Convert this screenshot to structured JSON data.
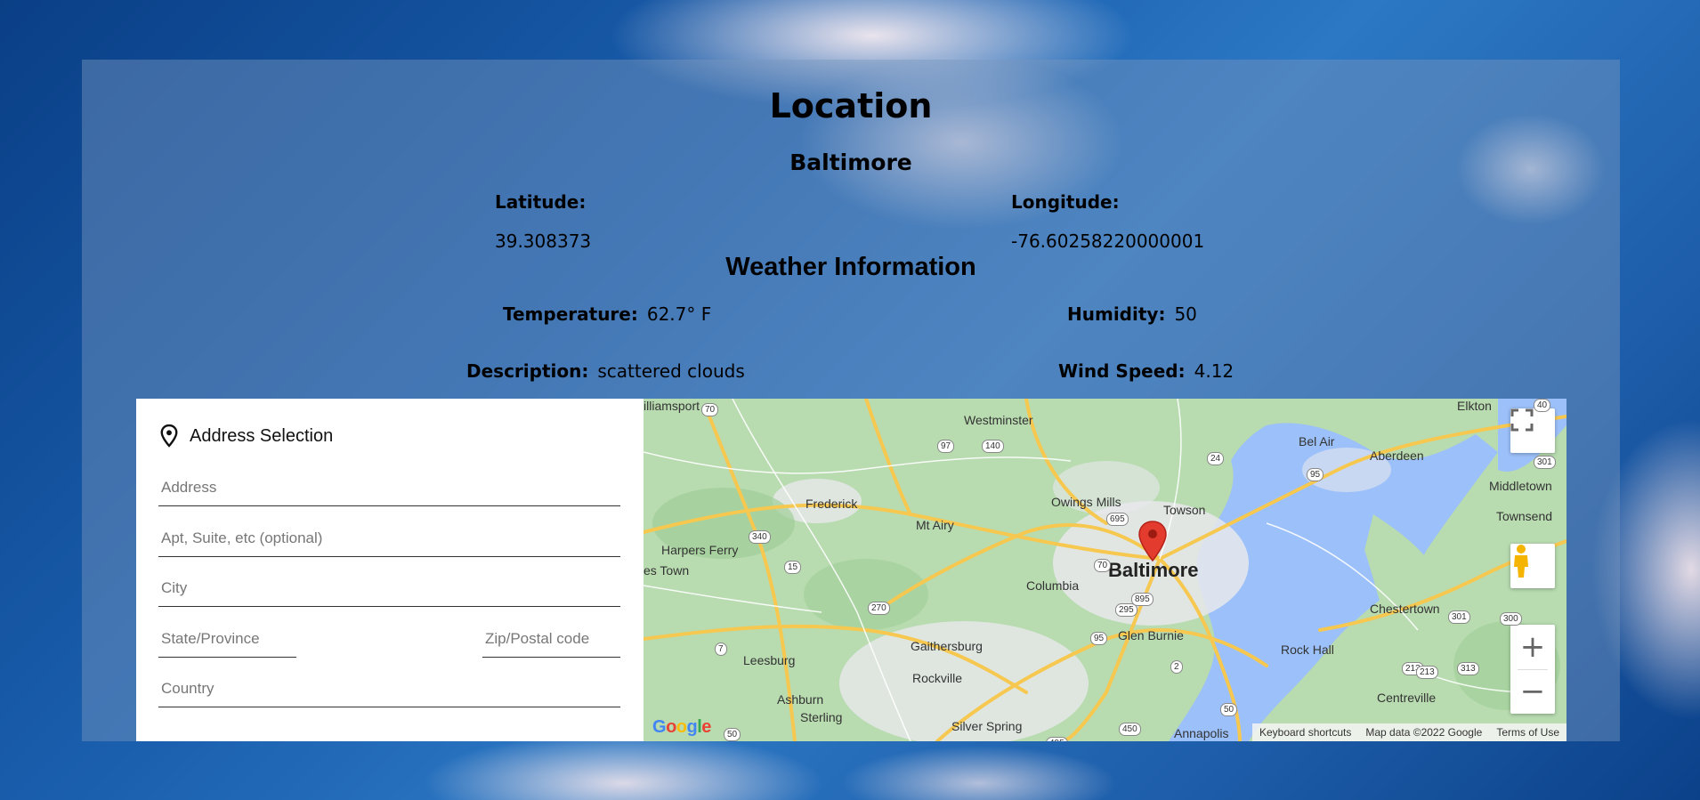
{
  "location": {
    "heading": "Location",
    "city": "Baltimore",
    "latitude_label": "Latitude:",
    "latitude_value": "39.308373",
    "longitude_label": "Longitude:",
    "longitude_value": "-76.60258220000001"
  },
  "weather": {
    "heading": "Weather Information",
    "temperature_label": "Temperature:",
    "temperature_value": "62.7° F",
    "humidity_label": "Humidity:",
    "humidity_value": "50",
    "description_label": "Description:",
    "description_value": "scattered clouds",
    "wind_label": "Wind Speed:",
    "wind_value": "4.12"
  },
  "address_form": {
    "title": "Address Selection",
    "icon": "location-pin-icon",
    "address_placeholder": "Address",
    "apt_placeholder": "Apt, Suite, etc (optional)",
    "city_placeholder": "City",
    "state_placeholder": "State/Province",
    "zip_placeholder": "Zip/Postal code",
    "country_placeholder": "Country"
  },
  "map": {
    "labels": {
      "williamsport": "illiamsport",
      "westminster": "Westminster",
      "bel_air": "Bel Air",
      "aberdeen": "Aberdeen",
      "elkton": "Elkton",
      "frederick": "Frederick",
      "owings_mills": "Owings Mills",
      "towson": "Towson",
      "middletown": "Middletown",
      "townsend": "Townsend",
      "mt_airy": "Mt Airy",
      "harpers_ferry": "Harpers Ferry",
      "charles_town": "es Town",
      "baltimore": "Baltimore",
      "columbia": "Columbia",
      "glen_burnie": "Glen Burnie",
      "chestertown": "Chestertown",
      "gaithersburg": "Gaithersburg",
      "leesburg": "Leesburg",
      "rock_hall": "Rock Hall",
      "rockville": "Rockville",
      "centreville": "Centreville",
      "ashburn": "Ashburn",
      "sterling": "Sterling",
      "silver_spring": "Silver Spring",
      "annapolis": "Annapolis"
    },
    "shields": [
      "70",
      "97",
      "140",
      "24",
      "95",
      "301",
      "40",
      "695",
      "340",
      "15",
      "70",
      "895",
      "270",
      "295",
      "95",
      "301",
      "300",
      "7",
      "2",
      "313",
      "213",
      "50",
      "450",
      "495",
      "50",
      "213"
    ],
    "google_logo": "Google",
    "attribution": {
      "shortcuts": "Keyboard shortcuts",
      "map_data": "Map data ©2022 Google",
      "terms": "Terms of Use"
    },
    "zoom_in": "+",
    "zoom_out": "−",
    "colors": {
      "water": "#9cc0f9",
      "land": "#b8dbb0",
      "urban": "#e8e8ec",
      "road": "#f7c850",
      "marker": "#e33b2e"
    }
  }
}
